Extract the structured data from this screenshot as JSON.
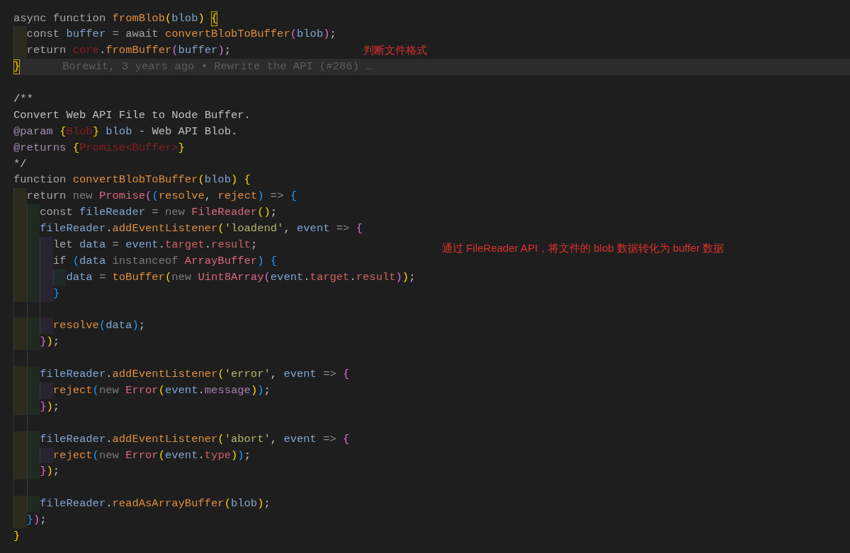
{
  "lines": [
    {
      "kind": "code",
      "current": false,
      "tokens": [
        {
          "text": "async ",
          "color": "#a6a6a6"
        },
        {
          "text": "function ",
          "color": "#a6a6a6"
        },
        {
          "text": "fromBlob",
          "color": "#df8e3f"
        },
        {
          "text": "(",
          "color": "#ffd700"
        },
        {
          "text": "blob",
          "color": "#7ea5d0"
        },
        {
          "text": ") ",
          "color": "#ffd700"
        },
        {
          "text": "{",
          "color": "#ffd700",
          "matched": true
        }
      ],
      "children": [
        {
          "kind": "code",
          "current": false,
          "tokens": [
            {
              "text": "const ",
              "color": "#a6a6a6"
            },
            {
              "text": "buffer ",
              "color": "#7ea5d0"
            },
            {
              "text": "= ",
              "color": "#8c8c8c"
            },
            {
              "text": "await ",
              "color": "#a6a6a6"
            },
            {
              "text": "convertBlobToBuffer",
              "color": "#df8e3f"
            },
            {
              "text": "(",
              "color": "#da70d6"
            },
            {
              "text": "blob",
              "color": "#7ea5d0"
            },
            {
              "text": ")",
              "color": "#da70d6"
            },
            {
              "text": ";",
              "color": "#c4c4c4"
            }
          ]
        },
        {
          "kind": "code",
          "current": false,
          "tokens": [
            {
              "text": "return ",
              "color": "#a6a6a6"
            },
            {
              "text": "core",
              "color": "#8b1c1c"
            },
            {
              "text": "."
            },
            {
              "text": "fromBuffer",
              "color": "#df8e3f"
            },
            {
              "text": "(",
              "color": "#da70d6"
            },
            {
              "text": "buffer",
              "color": "#7ea5d0"
            },
            {
              "text": ")",
              "color": "#da70d6"
            },
            {
              "text": ";",
              "color": "#c4c4c4"
            }
          ],
          "note": "判断文件格式"
        }
      ]
    },
    {
      "kind": "code",
      "current": true,
      "tokens": [
        {
          "text": "}",
          "color": "#ffd700",
          "matched": true
        }
      ],
      "blame": "Borewit, 3 years ago • Rewrite the API (#286) …"
    },
    {
      "kind": "blank",
      "current": false
    },
    {
      "kind": "code",
      "current": false,
      "tokens": [
        {
          "text": "/**",
          "color": "#c0c0c0"
        }
      ]
    },
    {
      "kind": "code",
      "current": false,
      "tokens": [
        {
          "text": "Convert Web API File to Node Buffer.",
          "color": "#c0c0c0"
        }
      ]
    },
    {
      "kind": "code",
      "current": false,
      "tokens": [
        {
          "text": "@param ",
          "color": "#a58ab0"
        },
        {
          "text": "{",
          "color": "#ffd700"
        },
        {
          "text": "Blob",
          "color": "#8b1c1c"
        },
        {
          "text": "} ",
          "color": "#ffd700"
        },
        {
          "text": "blob ",
          "color": "#7ea5d0"
        },
        {
          "text": "- Web API Blob.",
          "color": "#c0c0c0"
        }
      ]
    },
    {
      "kind": "code",
      "current": false,
      "tokens": [
        {
          "text": "@returns ",
          "color": "#a58ab0"
        },
        {
          "text": "{",
          "color": "#ffd700"
        },
        {
          "text": "Promise<Buffer>",
          "color": "#8b1c1c"
        },
        {
          "text": "}",
          "color": "#ffd700"
        }
      ]
    },
    {
      "kind": "code",
      "current": false,
      "tokens": [
        {
          "text": "*/",
          "color": "#c0c0c0"
        }
      ]
    },
    {
      "kind": "code",
      "current": false,
      "tokens": [
        {
          "text": "function ",
          "color": "#a6a6a6"
        },
        {
          "text": "convertBlobToBuffer",
          "color": "#df8e3f"
        },
        {
          "text": "(",
          "color": "#ffd700"
        },
        {
          "text": "blob",
          "color": "#7ea5d0"
        },
        {
          "text": ") ",
          "color": "#ffd700"
        },
        {
          "text": "{",
          "color": "#ffd700"
        }
      ],
      "children": [
        {
          "kind": "code",
          "current": false,
          "tokens": [
            {
              "text": "return ",
              "color": "#a6a6a6"
            },
            {
              "text": "new ",
              "color": "#7a7a7a"
            },
            {
              "text": "Promise",
              "color": "#d9687a"
            },
            {
              "text": "(",
              "color": "#da70d6"
            },
            {
              "text": "(",
              "color": "#179fff"
            },
            {
              "text": "resolve",
              "color": "#df8e3f"
            },
            {
              "text": ", ",
              "color": "#c4c4c4"
            },
            {
              "text": "reject",
              "color": "#df8e3f"
            },
            {
              "text": ") ",
              "color": "#179fff"
            },
            {
              "text": "=> ",
              "color": "#8c8c8c"
            },
            {
              "text": "{",
              "color": "#179fff"
            }
          ],
          "children": [
            {
              "kind": "code",
              "current": false,
              "tokens": [
                {
                  "text": "const ",
                  "color": "#a6a6a6"
                },
                {
                  "text": "fileReader ",
                  "color": "#7ea5d0"
                },
                {
                  "text": "= ",
                  "color": "#8c8c8c"
                },
                {
                  "text": "new ",
                  "color": "#7a7a7a"
                },
                {
                  "text": "FileReader",
                  "color": "#d9687a"
                },
                {
                  "text": "()",
                  "color": "#ffd700"
                },
                {
                  "text": ";",
                  "color": "#c4c4c4"
                }
              ]
            },
            {
              "kind": "code",
              "current": false,
              "tokens": [
                {
                  "text": "fileReader",
                  "color": "#7ea5d0"
                },
                {
                  "text": "."
                },
                {
                  "text": "addEventListener",
                  "color": "#df8e3f"
                },
                {
                  "text": "(",
                  "color": "#ffd700"
                },
                {
                  "text": "'loadend'",
                  "color": "#b5b56b"
                },
                {
                  "text": ", ",
                  "color": "#c4c4c4"
                },
                {
                  "text": "event ",
                  "color": "#7ea5d0"
                },
                {
                  "text": "=> ",
                  "color": "#8c8c8c"
                },
                {
                  "text": "{",
                  "color": "#da70d6"
                }
              ],
              "children": [
                {
                  "kind": "code",
                  "current": false,
                  "tokens": [
                    {
                      "text": "let ",
                      "color": "#a6a6a6"
                    },
                    {
                      "text": "data ",
                      "color": "#7ea5d0"
                    },
                    {
                      "text": "= ",
                      "color": "#8c8c8c"
                    },
                    {
                      "text": "event",
                      "color": "#7ea5d0"
                    },
                    {
                      "text": "."
                    },
                    {
                      "text": "target",
                      "color": "#cf6360"
                    },
                    {
                      "text": "."
                    },
                    {
                      "text": "result",
                      "color": "#cf6360"
                    },
                    {
                      "text": ";",
                      "color": "#c4c4c4"
                    }
                  ],
                  "note": "通过 FileReader API，将文件的 blob 数据转化为 buffer 数据"
                },
                {
                  "kind": "code",
                  "current": false,
                  "tokens": [
                    {
                      "text": "if ",
                      "color": "#a6a6a6"
                    },
                    {
                      "text": "(",
                      "color": "#179fff"
                    },
                    {
                      "text": "data ",
                      "color": "#7ea5d0"
                    },
                    {
                      "text": "instanceof ",
                      "color": "#7a7a7a"
                    },
                    {
                      "text": "ArrayBuffer",
                      "color": "#d9687a"
                    },
                    {
                      "text": ") ",
                      "color": "#179fff"
                    },
                    {
                      "text": "{",
                      "color": "#179fff"
                    }
                  ],
                  "children": [
                    {
                      "kind": "code",
                      "current": false,
                      "tokens": [
                        {
                          "text": "data ",
                          "color": "#7ea5d0"
                        },
                        {
                          "text": "= ",
                          "color": "#8c8c8c"
                        },
                        {
                          "text": "toBuffer",
                          "color": "#df8e3f"
                        },
                        {
                          "text": "(",
                          "color": "#ffd700"
                        },
                        {
                          "text": "new ",
                          "color": "#7a7a7a"
                        },
                        {
                          "text": "Uint8Array",
                          "color": "#d9687a"
                        },
                        {
                          "text": "(",
                          "color": "#da70d6"
                        },
                        {
                          "text": "event",
                          "color": "#7ea5d0"
                        },
                        {
                          "text": "."
                        },
                        {
                          "text": "target",
                          "color": "#cf6360"
                        },
                        {
                          "text": "."
                        },
                        {
                          "text": "result",
                          "color": "#cf6360"
                        },
                        {
                          "text": ")",
                          "color": "#da70d6"
                        },
                        {
                          "text": ")",
                          "color": "#ffd700"
                        },
                        {
                          "text": ";",
                          "color": "#c4c4c4"
                        }
                      ]
                    }
                  ]
                },
                {
                  "kind": "code",
                  "current": false,
                  "tokens": [
                    {
                      "text": "}",
                      "color": "#179fff"
                    }
                  ]
                },
                {
                  "kind": "blank",
                  "current": false
                },
                {
                  "kind": "code",
                  "current": false,
                  "tokens": [
                    {
                      "text": "resolve",
                      "color": "#df8e3f"
                    },
                    {
                      "text": "(",
                      "color": "#179fff"
                    },
                    {
                      "text": "data",
                      "color": "#7ea5d0"
                    },
                    {
                      "text": ")",
                      "color": "#179fff"
                    },
                    {
                      "text": ";",
                      "color": "#c4c4c4"
                    }
                  ]
                }
              ]
            },
            {
              "kind": "code",
              "current": false,
              "tokens": [
                {
                  "text": "}",
                  "color": "#da70d6"
                },
                {
                  "text": ")",
                  "color": "#ffd700"
                },
                {
                  "text": ";",
                  "color": "#c4c4c4"
                }
              ]
            },
            {
              "kind": "blank",
              "current": false
            },
            {
              "kind": "code",
              "current": false,
              "tokens": [
                {
                  "text": "fileReader",
                  "color": "#7ea5d0"
                },
                {
                  "text": "."
                },
                {
                  "text": "addEventListener",
                  "color": "#df8e3f"
                },
                {
                  "text": "(",
                  "color": "#ffd700"
                },
                {
                  "text": "'error'",
                  "color": "#b5b56b"
                },
                {
                  "text": ", ",
                  "color": "#c4c4c4"
                },
                {
                  "text": "event ",
                  "color": "#7ea5d0"
                },
                {
                  "text": "=> ",
                  "color": "#8c8c8c"
                },
                {
                  "text": "{",
                  "color": "#da70d6"
                }
              ],
              "children": [
                {
                  "kind": "code",
                  "current": false,
                  "tokens": [
                    {
                      "text": "reject",
                      "color": "#df8e3f"
                    },
                    {
                      "text": "(",
                      "color": "#179fff"
                    },
                    {
                      "text": "new ",
                      "color": "#7a7a7a"
                    },
                    {
                      "text": "Error",
                      "color": "#d9687a"
                    },
                    {
                      "text": "(",
                      "color": "#ffd700"
                    },
                    {
                      "text": "event",
                      "color": "#7ea5d0"
                    },
                    {
                      "text": "."
                    },
                    {
                      "text": "message",
                      "color": "#a47fae"
                    },
                    {
                      "text": ")",
                      "color": "#ffd700"
                    },
                    {
                      "text": ")",
                      "color": "#179fff"
                    },
                    {
                      "text": ";",
                      "color": "#c4c4c4"
                    }
                  ]
                }
              ]
            },
            {
              "kind": "code",
              "current": false,
              "tokens": [
                {
                  "text": "}",
                  "color": "#da70d6"
                },
                {
                  "text": ")",
                  "color": "#ffd700"
                },
                {
                  "text": ";",
                  "color": "#c4c4c4"
                }
              ]
            },
            {
              "kind": "blank",
              "current": false
            },
            {
              "kind": "code",
              "current": false,
              "tokens": [
                {
                  "text": "fileReader",
                  "color": "#7ea5d0"
                },
                {
                  "text": "."
                },
                {
                  "text": "addEventListener",
                  "color": "#df8e3f"
                },
                {
                  "text": "(",
                  "color": "#ffd700"
                },
                {
                  "text": "'abort'",
                  "color": "#b5b56b"
                },
                {
                  "text": ", ",
                  "color": "#c4c4c4"
                },
                {
                  "text": "event ",
                  "color": "#7ea5d0"
                },
                {
                  "text": "=> ",
                  "color": "#8c8c8c"
                },
                {
                  "text": "{",
                  "color": "#da70d6"
                }
              ],
              "children": [
                {
                  "kind": "code",
                  "current": false,
                  "tokens": [
                    {
                      "text": "reject",
                      "color": "#df8e3f"
                    },
                    {
                      "text": "(",
                      "color": "#179fff"
                    },
                    {
                      "text": "new ",
                      "color": "#7a7a7a"
                    },
                    {
                      "text": "Error",
                      "color": "#d9687a"
                    },
                    {
                      "text": "(",
                      "color": "#ffd700"
                    },
                    {
                      "text": "event",
                      "color": "#7ea5d0"
                    },
                    {
                      "text": "."
                    },
                    {
                      "text": "type",
                      "color": "#cf6360"
                    },
                    {
                      "text": ")",
                      "color": "#ffd700"
                    },
                    {
                      "text": ")",
                      "color": "#179fff"
                    },
                    {
                      "text": ";",
                      "color": "#c4c4c4"
                    }
                  ]
                }
              ]
            },
            {
              "kind": "code",
              "current": false,
              "tokens": [
                {
                  "text": "}",
                  "color": "#da70d6"
                },
                {
                  "text": ")",
                  "color": "#ffd700"
                },
                {
                  "text": ";",
                  "color": "#c4c4c4"
                }
              ]
            },
            {
              "kind": "blank",
              "current": false
            },
            {
              "kind": "code",
              "current": false,
              "tokens": [
                {
                  "text": "fileReader",
                  "color": "#7ea5d0"
                },
                {
                  "text": "."
                },
                {
                  "text": "readAsArrayBuffer",
                  "color": "#df8e3f"
                },
                {
                  "text": "(",
                  "color": "#ffd700"
                },
                {
                  "text": "blob",
                  "color": "#7ea5d0"
                },
                {
                  "text": ")",
                  "color": "#ffd700"
                },
                {
                  "text": ";",
                  "color": "#c4c4c4"
                }
              ]
            }
          ]
        },
        {
          "kind": "code",
          "current": false,
          "tokens": [
            {
              "text": "}",
              "color": "#179fff"
            },
            {
              "text": ")",
              "color": "#da70d6"
            },
            {
              "text": ";",
              "color": "#c4c4c4"
            }
          ]
        }
      ]
    },
    {
      "kind": "code",
      "current": false,
      "tokens": [
        {
          "text": "}",
          "color": "#ffd700"
        }
      ]
    }
  ]
}
